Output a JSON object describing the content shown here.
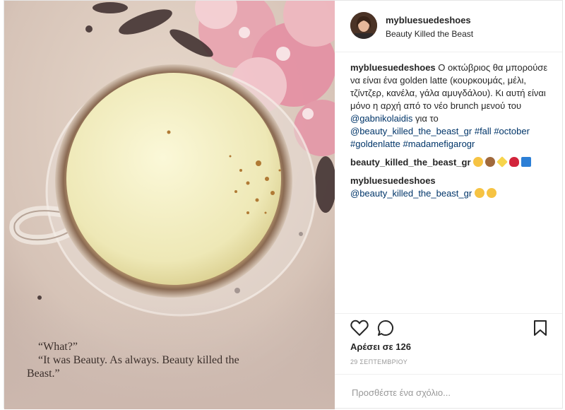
{
  "post": {
    "username": "mybluesuedeshoes",
    "location": "Beauty Killed the Beast",
    "caption": {
      "username": "mybluesuedeshoes",
      "text": "Ο οκτώβριος θα μπορούσε να είναι ένα golden latte (κουρκουμάς, μέλι, τζίντζερ, κανέλα, γάλα αμυγδάλου). Κι αυτή είναι μόνο η αρχή από το νέο brunch μενού του",
      "mention1": "@gabnikolaidis",
      "text2": "για το",
      "mention2": "@beauty_killed_the_beast_gr",
      "hashtags": [
        "#fall",
        "#october",
        "#goldenlatte",
        "#madamefigarogr"
      ]
    },
    "comments": [
      {
        "username": "beauty_killed_the_beast_gr",
        "emojis": [
          "smiling-face-kiss-emoji",
          "see-no-evil-monkey-emoji",
          "sparkles-emoji",
          "kiss-mark-emoji",
          "new-button-emoji"
        ]
      },
      {
        "username": "mybluesuedeshoes",
        "mention": "@beauty_killed_the_beast_gr",
        "emojis": [
          "yum-face-emoji",
          "smiling-face-kiss-emoji"
        ]
      }
    ],
    "likes_text": "Αρέσει σε 126",
    "date": "29 ΣΕΠΤΕΜΒΡΙΟΥ",
    "comment_placeholder": "Προσθέστε ένα σχόλιο...",
    "photo_quote": {
      "line1": "“What?”",
      "line2": "“It was Beauty. As always. Beauty killed the",
      "line3": "Beast.”"
    }
  }
}
